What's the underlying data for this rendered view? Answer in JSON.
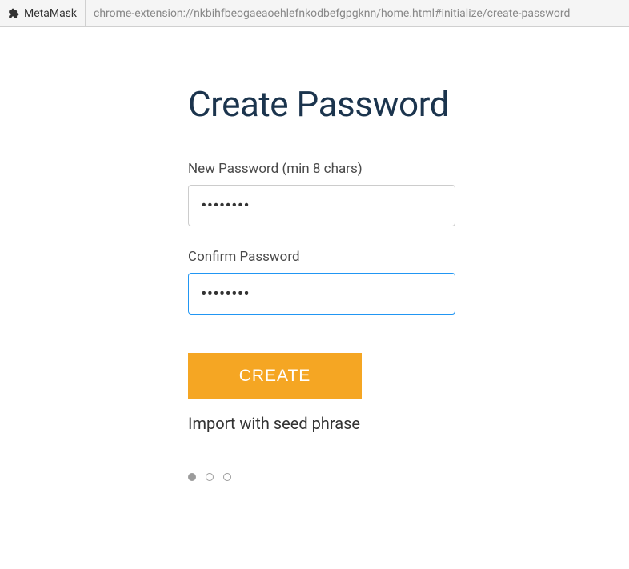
{
  "addressBar": {
    "extensionName": "MetaMask",
    "url": "chrome-extension://nkbihfbeogaeaoehlefnkodbefgpgknn/home.html#initialize/create-password"
  },
  "page": {
    "title": "Create Password"
  },
  "form": {
    "newPassword": {
      "label": "New Password (min 8 chars)",
      "value": "••••••••"
    },
    "confirmPassword": {
      "label": "Confirm Password",
      "value": "••••••••"
    },
    "createButton": "CREATE",
    "importLink": "Import with seed phrase"
  },
  "progress": {
    "currentStep": 1,
    "totalSteps": 3
  }
}
